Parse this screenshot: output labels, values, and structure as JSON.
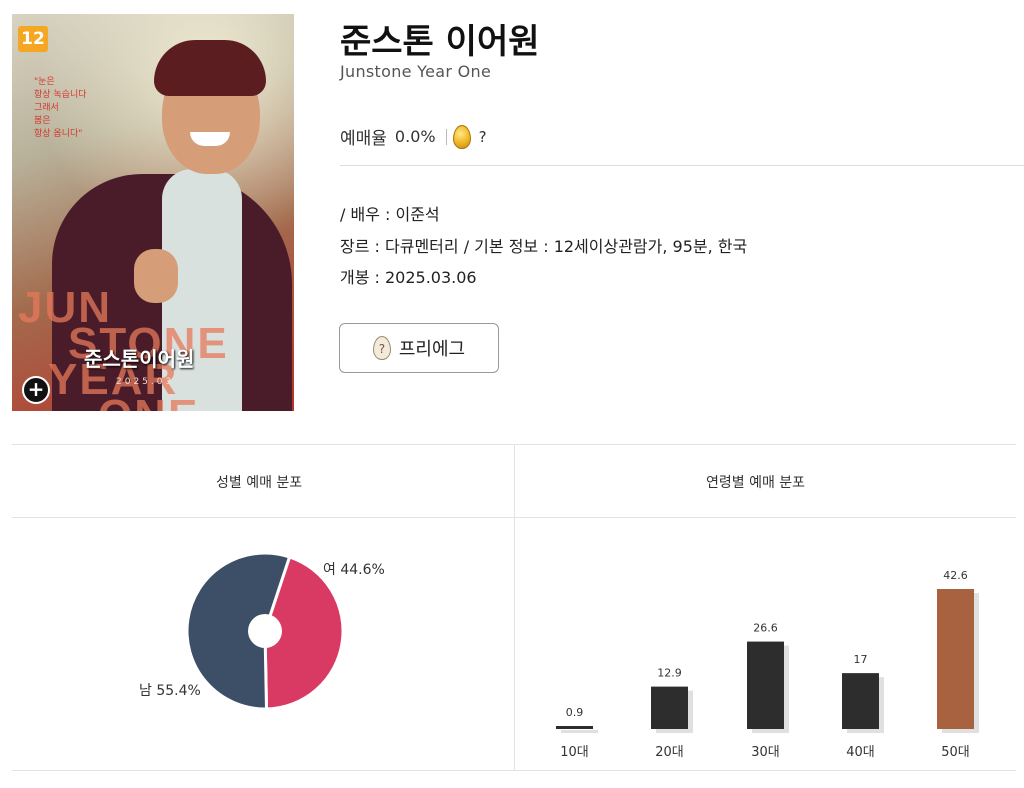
{
  "movie": {
    "title": "준스톤 이어원",
    "subtitle": "Junstone Year One",
    "rate_label": "예매율",
    "rate_value": "0.0%",
    "rate_help": "?",
    "actor_line": " / 배우 : 이준석",
    "genre_line": "장르 : 다큐멘터리 / 기본 정보 : 12세이상관람가, 95분, 한국",
    "release_line": "개봉 : 2025.03.06",
    "prefix_button": "프리에그",
    "prefix_icon_glyph": "?"
  },
  "poster": {
    "age_badge": "12",
    "quote": "\"눈은\n항상 녹습니다\n그래서\n봄은\n항상 옵니다\"",
    "big_words": [
      "JUN",
      "STONE",
      "YEAR",
      "ONE"
    ],
    "title": "준스톤이어원",
    "date": "2025.03",
    "expand_glyph": "+"
  },
  "stats": {
    "gender_title": "성별 예매 분포",
    "age_title": "연령별 예매 분포"
  },
  "chart_data": [
    {
      "type": "pie",
      "title": "성별 예매 분포",
      "categories": [
        "여",
        "남"
      ],
      "values": [
        44.6,
        55.4
      ],
      "labels": [
        "여 44.6%",
        "남 55.4%"
      ],
      "colors": [
        "#d93a63",
        "#3d4f66"
      ]
    },
    {
      "type": "bar",
      "title": "연령별 예매 분포",
      "categories": [
        "10대",
        "20대",
        "30대",
        "40대",
        "50대"
      ],
      "values": [
        0.9,
        12.9,
        26.6,
        17,
        42.6
      ],
      "value_labels": [
        "0.9",
        "12.9",
        "26.6",
        "17",
        "42.6"
      ],
      "colors": [
        "#2d2d2d",
        "#2d2d2d",
        "#2d2d2d",
        "#2d2d2d",
        "#a9623f"
      ],
      "ylim": [
        0,
        42.6
      ]
    }
  ]
}
